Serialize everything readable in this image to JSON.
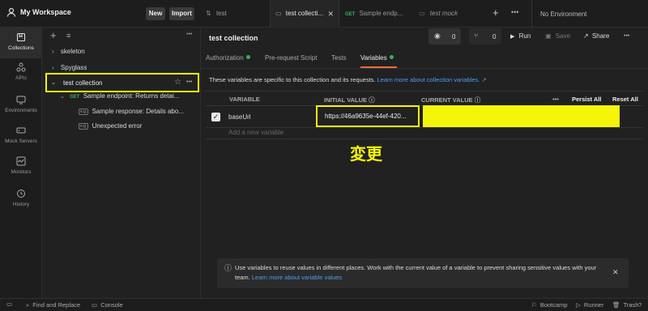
{
  "workspace": {
    "title": "My Workspace",
    "new_label": "New",
    "import_label": "Import"
  },
  "tabs": [
    {
      "label": "test"
    },
    {
      "label": "test collecti...",
      "active": true
    },
    {
      "method": "GET",
      "label": "Sample endp..."
    },
    {
      "label": "test mock"
    }
  ],
  "environment": {
    "selected": "No Environment"
  },
  "nav": [
    {
      "label": "Collections",
      "icon": "collections-icon",
      "active": true
    },
    {
      "label": "APIs",
      "icon": "apis-icon"
    },
    {
      "label": "Environments",
      "icon": "environments-icon"
    },
    {
      "label": "Mock Servers",
      "icon": "mock-servers-icon"
    },
    {
      "label": "Monitors",
      "icon": "monitors-icon"
    },
    {
      "label": "History",
      "icon": "history-icon"
    }
  ],
  "sidebar": {
    "items": [
      {
        "label": "skeleton"
      },
      {
        "label": "Spyglass"
      },
      {
        "label": "test collection"
      },
      {
        "method": "GET",
        "label": "Sample endpoint: Returns detai..."
      },
      {
        "badge": "e.g.",
        "label": "Sample response: Details abo..."
      },
      {
        "badge": "e.g.",
        "label": "Unexpected error"
      }
    ]
  },
  "collection": {
    "title": "test collection",
    "watch_count": "0",
    "fork_count": "0",
    "run_label": "Run",
    "save_label": "Save",
    "share_label": "Share"
  },
  "subtabs": [
    {
      "label": "Authorization",
      "dot": true
    },
    {
      "label": "Pre-request Script"
    },
    {
      "label": "Tests"
    },
    {
      "label": "Variables",
      "dot": true,
      "active": true
    }
  ],
  "variables": {
    "info": "These variables are specific to this collection and its requests.",
    "info_link": "Learn more about collection variables. ↗",
    "headers": {
      "variable": "VARIABLE",
      "initial": "INITIAL VALUE",
      "current": "CURRENT VALUE",
      "persist": "Persist All",
      "reset": "Reset All"
    },
    "rows": [
      {
        "checked": true,
        "name": "baseUrl",
        "initial": "https://46a9635e-44ef-420...",
        "current": ""
      }
    ],
    "add_placeholder": "Add a new variable",
    "annotation": "変更"
  },
  "banner": {
    "text": "Use variables to reuse values in different places. Work with the current value of a variable to prevent sharing sensitive values with your team.",
    "link": "Learn more about variable values"
  },
  "statusbar": {
    "find_replace": "Find and Replace",
    "console": "Console",
    "bootcamp": "Bootcamp",
    "runner": "Runner",
    "trash": "Trash"
  },
  "colors": {
    "accent": "#f26b3a",
    "highlight": "#f5f50a",
    "link": "#4d9ef7",
    "success": "#3fae5d"
  }
}
